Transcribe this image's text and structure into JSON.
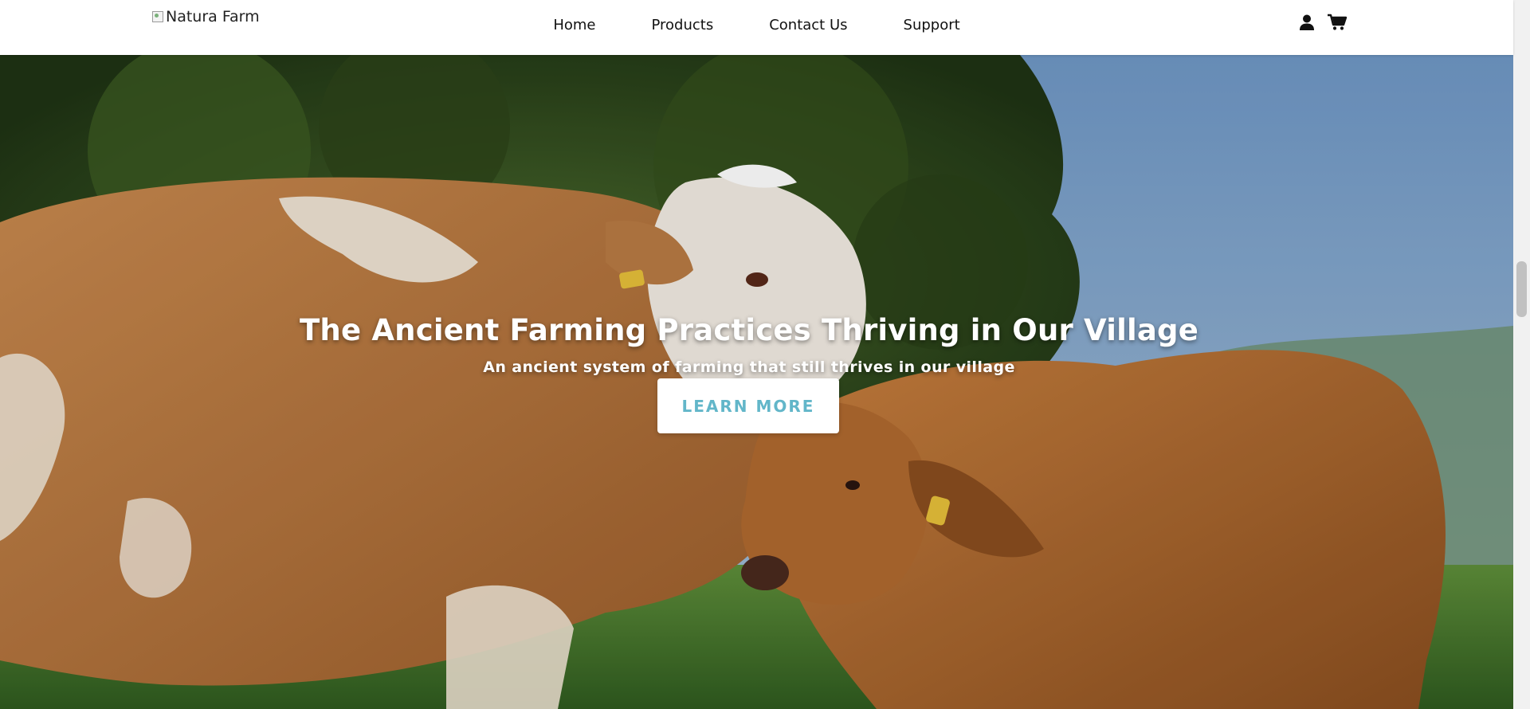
{
  "header": {
    "logo_alt": "Natura Farm",
    "nav": [
      {
        "label": "Home"
      },
      {
        "label": "Products"
      },
      {
        "label": "Contact Us"
      },
      {
        "label": "Support"
      }
    ],
    "icons": [
      "user-icon",
      "cart-icon"
    ]
  },
  "hero": {
    "title": "The Ancient Farming Practices Thriving in Our Village",
    "subtitle": "An ancient system of farming that still thrives in our village",
    "cta_label": "LEARN MORE"
  },
  "colors": {
    "cta_text": "#62b6c9",
    "header_bg": "#ffffff"
  }
}
